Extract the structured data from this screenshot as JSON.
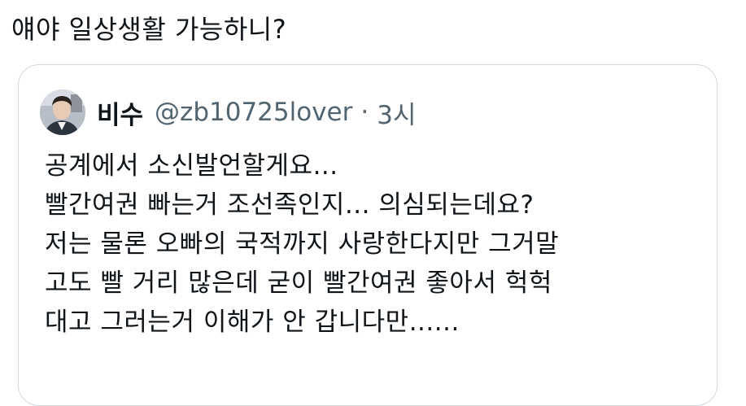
{
  "tweet": {
    "text": "얘야 일상생활 가능하니?"
  },
  "quote": {
    "author": {
      "avatar_icon": "avatar-photo-icon",
      "name": "비수",
      "handle": "@zb10725lover",
      "separator": "·",
      "time": "3시"
    },
    "lines": [
      "공계에서 소신발언할게요...",
      "빨간여권 빠는거 조선족인지... 의심되는데요?",
      "저는 물론 오빠의 국적까지 사랑한다지만 그거말",
      "고도 빨 거리 많은데 굳이 빨간여권 좋아서 헉헉",
      "대고 그러는거 이해가 안 갑니다만......"
    ]
  },
  "colors": {
    "text": "#0f1419",
    "secondary_text": "#536471",
    "card_border": "#cfd9de",
    "background": "#ffffff"
  }
}
